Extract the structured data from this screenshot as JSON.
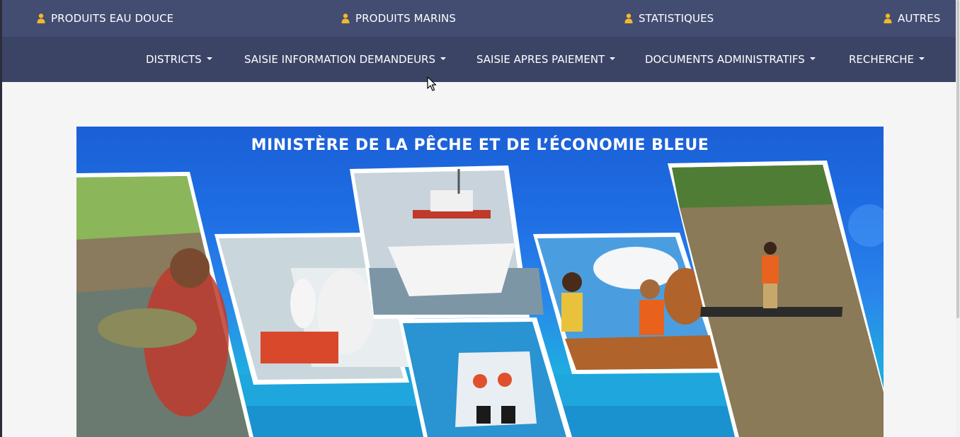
{
  "top_menu": {
    "items": [
      {
        "label": "PRODUITS EAU DOUCE",
        "icon": "user-icon"
      },
      {
        "label": "PRODUITS MARINS",
        "icon": "user-icon"
      },
      {
        "label": "STATISTIQUES",
        "icon": "user-icon"
      },
      {
        "label": "AUTRES",
        "icon": "user-icon"
      }
    ]
  },
  "main_nav": {
    "items": [
      {
        "label": "DISTRICTS",
        "icon": "caret-down-icon"
      },
      {
        "label": "SAISIE INFORMATION DEMANDEURS",
        "icon": "caret-down-icon"
      },
      {
        "label": "SAISIE APRES PAIEMENT",
        "icon": "caret-down-icon"
      },
      {
        "label": "DOCUMENTS ADMINISTRATIFS",
        "icon": "caret-down-icon"
      },
      {
        "label": "RECHERCHE",
        "icon": "caret-down-icon"
      }
    ]
  },
  "banner": {
    "title": "MINISTÈRE DE LA PÊCHE ET DE L’ÉCONOMIE BLEUE"
  },
  "colors": {
    "topbar_bg": "#434d72",
    "navbar_bg": "#3c4466",
    "icon_accent": "#f4b72a",
    "page_bg": "#f5f5f5"
  }
}
